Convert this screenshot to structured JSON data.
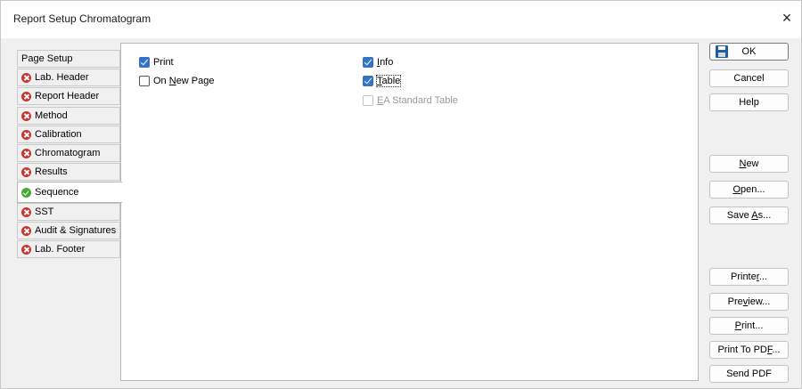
{
  "window": {
    "title": "Report Setup Chromatogram",
    "close_glyph": "×"
  },
  "tabs": [
    {
      "label": "Page Setup",
      "status": "none"
    },
    {
      "label": "Lab. Header",
      "status": "error"
    },
    {
      "label": "Report Header",
      "status": "error"
    },
    {
      "label": "Method",
      "status": "error"
    },
    {
      "label": "Calibration",
      "status": "error"
    },
    {
      "label": "Chromatogram",
      "status": "error"
    },
    {
      "label": "Results",
      "status": "error"
    },
    {
      "label": "Sequence",
      "status": "ok",
      "active": true
    },
    {
      "label": "SST",
      "status": "error"
    },
    {
      "label": "Audit & Signatures",
      "status": "error"
    },
    {
      "label": "Lab. Footer",
      "status": "error"
    }
  ],
  "options": {
    "print": {
      "label": "Print",
      "checked": true
    },
    "on_new_page": {
      "label_pre": "On ",
      "label_u": "N",
      "label_post": "ew Page",
      "checked": false
    },
    "info": {
      "label_u": "I",
      "label_post": "nfo",
      "checked": true
    },
    "table": {
      "label_u": "T",
      "label_post": "able",
      "checked": true
    },
    "ea_standard_table": {
      "label_u": "E",
      "label_post": "A Standard Table",
      "checked": false,
      "disabled": true
    }
  },
  "buttons": {
    "ok": "OK",
    "cancel": "Cancel",
    "help": "Help",
    "new": {
      "u": "N",
      "post": "ew"
    },
    "open": {
      "u": "O",
      "post": "pen..."
    },
    "save_as": {
      "pre": "Save ",
      "u": "A",
      "post": "s..."
    },
    "printer": {
      "pre": "Printe",
      "u": "r",
      "post": "..."
    },
    "preview": {
      "pre": "Pre",
      "u": "v",
      "post": "iew..."
    },
    "print": {
      "u": "P",
      "post": "rint..."
    },
    "print_to_pdf": {
      "pre": "Print To PD",
      "u": "F",
      "post": "..."
    },
    "send_pdf": "Send PDF"
  },
  "colors": {
    "error": "#c8352a",
    "ok": "#4aa83a",
    "checkbox": "#3573c6"
  }
}
